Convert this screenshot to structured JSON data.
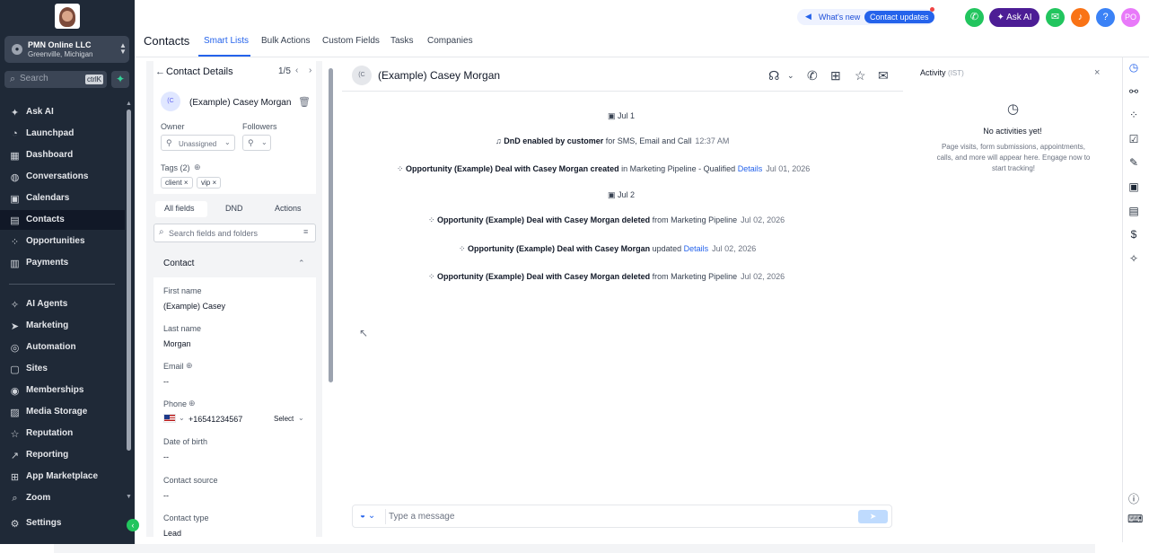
{
  "sidebar": {
    "account": {
      "name": "PMN Online LLC",
      "location": "Greenville, Michigan"
    },
    "search": {
      "placeholder": "Search",
      "shortcut": "ctrlK"
    },
    "items": [
      {
        "label": "Ask AI",
        "icon": "sparkle-icon"
      },
      {
        "label": "Launchpad",
        "icon": "rocket-icon"
      },
      {
        "label": "Dashboard",
        "icon": "dashboard-icon"
      },
      {
        "label": "Conversations",
        "icon": "chat-icon"
      },
      {
        "label": "Calendars",
        "icon": "calendar-icon"
      },
      {
        "label": "Contacts",
        "icon": "contacts-icon",
        "active": true
      },
      {
        "label": "Opportunities",
        "icon": "pipeline-icon"
      },
      {
        "label": "Payments",
        "icon": "payments-icon"
      },
      {
        "label": "AI Agents",
        "icon": "ai-agent-icon"
      },
      {
        "label": "Marketing",
        "icon": "send-icon"
      },
      {
        "label": "Automation",
        "icon": "automation-icon"
      },
      {
        "label": "Sites",
        "icon": "sites-icon"
      },
      {
        "label": "Memberships",
        "icon": "membership-icon"
      },
      {
        "label": "Media Storage",
        "icon": "media-icon"
      },
      {
        "label": "Reputation",
        "icon": "star-icon"
      },
      {
        "label": "Reporting",
        "icon": "chart-icon"
      },
      {
        "label": "App Marketplace",
        "icon": "apps-icon"
      },
      {
        "label": "Zoom",
        "icon": "zoom-icon"
      },
      {
        "label": "Settings",
        "icon": "gear-icon"
      }
    ]
  },
  "header": {
    "title": "Contacts",
    "tabs": [
      "Smart Lists",
      "Bulk Actions",
      "Custom Fields",
      "Tasks",
      "Companies"
    ],
    "whats_new": "What's new",
    "contact_updates": "Contact updates",
    "ask_ai": "Ask AI",
    "avatar": "PO"
  },
  "details": {
    "title": "Contact Details",
    "pager": "1/5",
    "contact_initials": "(C",
    "contact_name": "(Example) Casey Morgan",
    "owner_label": "Owner",
    "owner_value": "Unassigned",
    "followers_label": "Followers",
    "tags_label": "Tags (2)",
    "tags": [
      "client",
      "vip"
    ],
    "tabs": [
      "All fields",
      "DND",
      "Actions"
    ],
    "search_placeholder": "Search fields and folders",
    "section": "Contact",
    "fields": {
      "first_name_label": "First name",
      "first_name": "(Example) Casey",
      "last_name_label": "Last name",
      "last_name": "Morgan",
      "email_label": "Email",
      "email": "--",
      "phone_label": "Phone",
      "phone": "+16541234567",
      "phone_type": "Select",
      "dob_label": "Date of birth",
      "dob": "--",
      "source_label": "Contact source",
      "source": "--",
      "type_label": "Contact type",
      "type": "Lead"
    }
  },
  "conversation": {
    "initials": "(C",
    "name": "(Example) Casey Morgan",
    "date1": "Jul 1",
    "date2": "Jul 2",
    "events": [
      {
        "pre": "",
        "bold": "DnD enabled by customer",
        "post": " for SMS, Email and Call",
        "link": "",
        "time": "12:37 AM"
      },
      {
        "pre": "",
        "bold": "Opportunity (Example) Deal with Casey Morgan created",
        "post": " in Marketing Pipeline - Qualified",
        "link": "Details",
        "time": "Jul 01, 2026"
      },
      {
        "pre": "",
        "bold": "Opportunity (Example) Deal with Casey Morgan deleted",
        "post": " from Marketing Pipeline",
        "link": "",
        "time": "Jul 02, 2026"
      },
      {
        "pre": "",
        "bold": "Opportunity (Example) Deal with Casey Morgan",
        "post": " updated",
        "link": "Details",
        "time": "Jul 02, 2026"
      },
      {
        "pre": "",
        "bold": "Opportunity (Example) Deal with Casey Morgan deleted",
        "post": " from Marketing Pipeline",
        "link": "",
        "time": "Jul 02, 2026"
      }
    ],
    "message_placeholder": "Type a message"
  },
  "activity": {
    "title": "Activity",
    "tz": "(IST)",
    "empty_title": "No activities yet!",
    "empty_desc": "Page visits, form submissions, appointments, calls, and more will appear here. Engage now to start tracking!"
  },
  "colors": {
    "sidebar": "#1f2937",
    "accent": "#2563eb",
    "green": "#22c55e"
  }
}
